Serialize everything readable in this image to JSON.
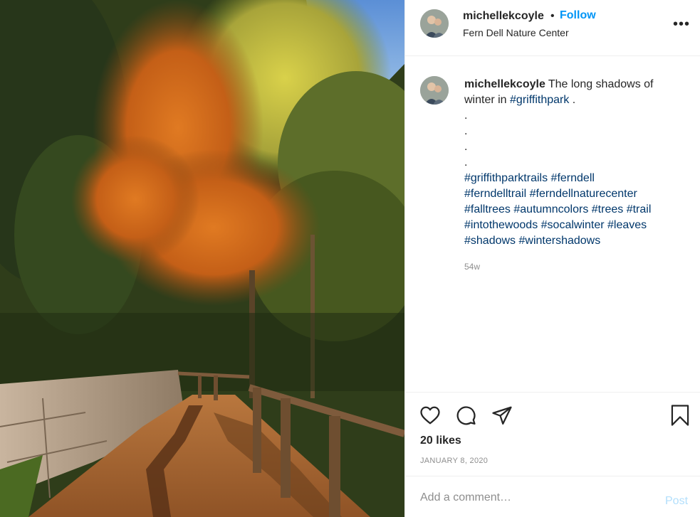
{
  "post": {
    "username": "michellekcoyle",
    "separator": "•",
    "follow_label": "Follow",
    "location": "Fern Dell Nature Center",
    "more_label": "•••",
    "caption": {
      "username": "michellekcoyle",
      "text": "The long shadows of winter in",
      "hashtag_inline": "#griffithpark",
      "after": ".",
      "dots": [
        ".",
        ".",
        ".",
        "."
      ],
      "hashtags": [
        "#griffithparktrails",
        "#ferndell",
        "#ferndelltrail",
        "#ferndellnaturecenter",
        "#falltrees",
        "#autumncolors",
        "#trees",
        "#trail",
        "#intothewoods",
        "#socalwinter",
        "#leaves",
        "#shadows",
        "#wintershadows"
      ],
      "time_ago": "54w"
    },
    "likes": "20 likes",
    "date": "JANUARY 8, 2020",
    "comment": {
      "placeholder": "Add a comment…",
      "post_label": "Post"
    }
  },
  "icons": {
    "like": "heart-icon",
    "comment": "comment-icon",
    "share": "paper-plane-icon",
    "save": "bookmark-icon"
  },
  "colors": {
    "accent": "#0095f6",
    "hashtag": "#00376b",
    "muted": "#8e8e8e",
    "post_disabled": "#b2dffc"
  }
}
